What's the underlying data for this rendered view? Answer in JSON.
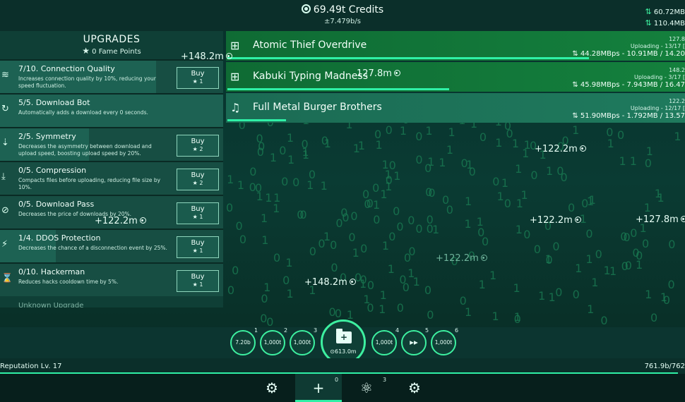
{
  "header": {
    "credits": "69.49t Credits",
    "rate": "±7.479b/s",
    "upload_stat": "60.72MB",
    "download_stat": "110.4MB"
  },
  "upgrades": {
    "title": "UPGRADES",
    "fame": "0 Fame Points",
    "items": [
      {
        "name": "7/10. Connection Quality",
        "desc": "Increases connection quality by 10%, reducing your speed fluctuation.",
        "buy": "Buy",
        "cost": "1",
        "icon": "wifi-icon",
        "progress": 0.7,
        "maxed": false
      },
      {
        "name": "5/5. Download Bot",
        "desc": "Automatically adds a download every 0 seconds.",
        "buy": "Buy",
        "cost": "",
        "icon": "bot-icon",
        "progress": 1.0,
        "maxed": true
      },
      {
        "name": "2/5. Symmetry",
        "desc": "Decreases the asymmetry between download and upload speed, boosting upload speed by 20%.",
        "buy": "Buy",
        "cost": "2",
        "icon": "symmetry-icon",
        "progress": 0.4,
        "maxed": false
      },
      {
        "name": "0/5. Compression",
        "desc": "Compacts files before uploading, reducing file size by 10%.",
        "buy": "Buy",
        "cost": "2",
        "icon": "compress-icon",
        "progress": 0.0,
        "maxed": false
      },
      {
        "name": "0/5. Download Pass",
        "desc": "Decreases the price of downloads by 20%.",
        "buy": "Buy",
        "cost": "1",
        "icon": "pass-icon",
        "progress": 0.0,
        "maxed": false
      },
      {
        "name": "1/4. DDOS Protection",
        "desc": "Decreases the chance of a disconnection event by 25%.",
        "buy": "Buy",
        "cost": "1",
        "icon": "shield-icon",
        "progress": 0.25,
        "maxed": false
      },
      {
        "name": "0/10. Hackerman",
        "desc": "Reduces hacks cooldown time by 5%.",
        "buy": "Buy",
        "cost": "1",
        "icon": "hacker-icon",
        "progress": 0.0,
        "maxed": false
      }
    ],
    "unknown": "Unknown Upgrade"
  },
  "downloads": [
    {
      "title": "Atomic Thief Overdrive",
      "icon": "gamepad-icon",
      "size": "127.8",
      "status": "Uploading - 13/17 [",
      "speed": "44.28MBps - 10.91MB / 14.20",
      "progress": 0.8
    },
    {
      "title": "Kabuki Typing Madness",
      "icon": "gamepad-icon",
      "size": "148.2",
      "status": "Uploading - 3/17 [",
      "speed": "45.98MBps - 7.943MB / 16.47",
      "progress": 0.49
    },
    {
      "title": "Full Metal Burger Brothers",
      "icon": "music-icon",
      "size": "122.2",
      "status": "Uploading - 12/17 [",
      "speed": "51.90MBps - 1.792MB / 13.57",
      "progress": 0.13
    }
  ],
  "floats": [
    "+148.2m",
    "127.8m",
    "+122.2m",
    "+122.2m",
    "+122.2m",
    "+127.8m",
    "+122.2m",
    "+148.2m",
    "+127.8m"
  ],
  "quickbar": {
    "slots": [
      {
        "num": "1",
        "label": "7.20b"
      },
      {
        "num": "2",
        "label": "1,000t"
      },
      {
        "num": "3",
        "label": "1,000t"
      },
      {
        "num": "4",
        "label": "1,000t"
      },
      {
        "num": "5",
        "label": "▶▶"
      },
      {
        "num": "6",
        "label": "1,000t"
      }
    ],
    "big_plus": "+",
    "big_cost": "613.0m"
  },
  "reputation": {
    "label": "Reputation Lv. 17",
    "value": "761.9b/762",
    "progress": 0.99
  },
  "nav": {
    "items": [
      {
        "icon": "cpu-icon",
        "glyph": "⚙",
        "num": ""
      },
      {
        "icon": "plus-icon",
        "glyph": "+",
        "num": "0"
      },
      {
        "icon": "atom-icon",
        "glyph": "⚛",
        "num": "3"
      },
      {
        "icon": "gear-icon",
        "glyph": "⚙",
        "num": ""
      }
    ]
  },
  "colors": {
    "accent": "#2ff0a6",
    "panel": "#174e43",
    "download_bg": "#137a3a"
  }
}
